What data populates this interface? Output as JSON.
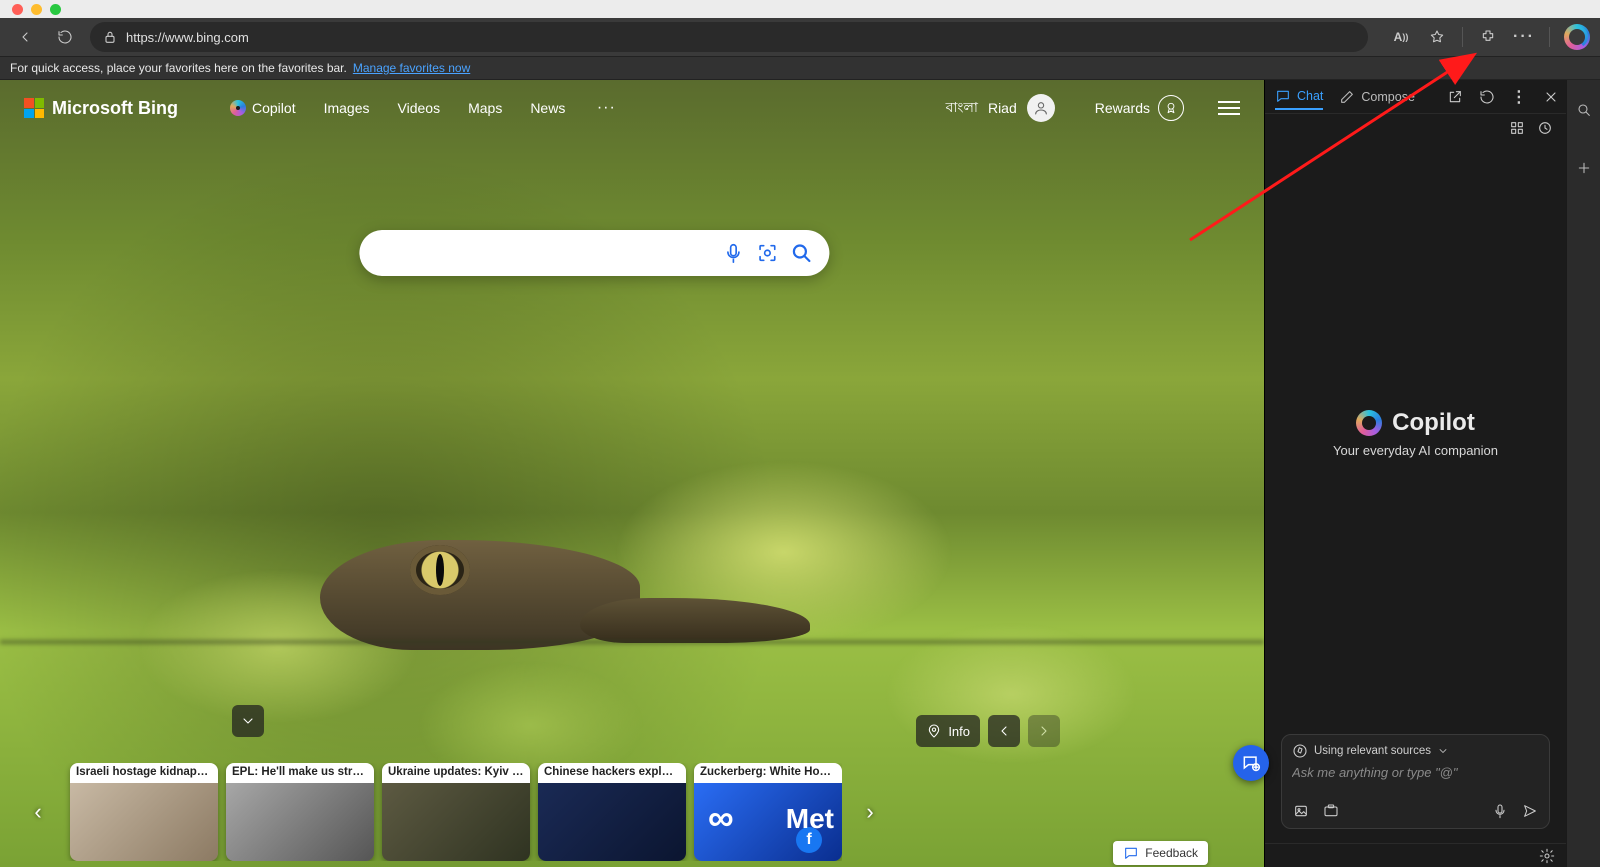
{
  "browser": {
    "url": "https://www.bing.com",
    "favorites_hint": "For quick access, place your favorites here on the favorites bar.",
    "manage_favorites": "Manage favorites now"
  },
  "bing": {
    "brand": "Microsoft Bing",
    "nav": {
      "copilot": "Copilot",
      "images": "Images",
      "videos": "Videos",
      "maps": "Maps",
      "news": "News"
    },
    "language": "বাংলা",
    "user_name": "Riad",
    "rewards_label": "Rewards",
    "search_placeholder": "",
    "info_label": "Info",
    "feedback_label": "Feedback",
    "cards": [
      "Israeli hostage kidnapped ...",
      "EPL: He'll make us stronger...",
      "Ukraine updates: Kyiv says ...",
      "Chinese hackers exploited ...",
      "Zuckerberg: White Hous..."
    ]
  },
  "copilot": {
    "tab_chat": "Chat",
    "tab_compose": "Compose",
    "title": "Copilot",
    "subtitle": "Your everyday AI companion",
    "sources_label": "Using relevant sources",
    "input_placeholder": "Ask me anything or type \"@\""
  }
}
